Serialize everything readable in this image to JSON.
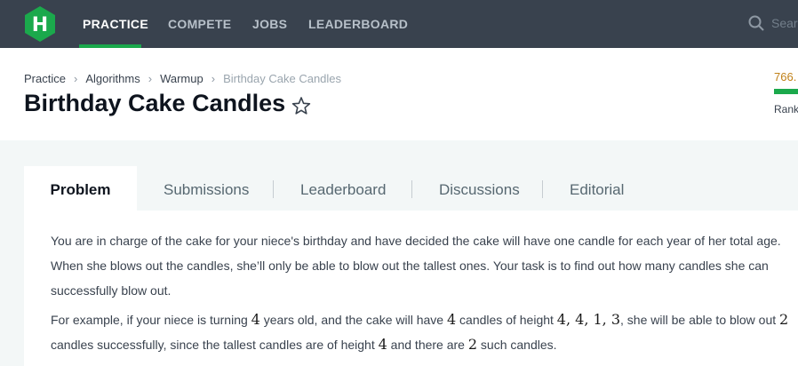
{
  "nav": {
    "items": [
      "PRACTICE",
      "COMPETE",
      "JOBS",
      "LEADERBOARD"
    ],
    "search_placeholder": "Sear"
  },
  "breadcrumb": [
    "Practice",
    "Algorithms",
    "Warmup",
    "Birthday Cake Candles"
  ],
  "title": "Birthday Cake Candles",
  "rank": {
    "points": "766.",
    "label": "Rank"
  },
  "tabs": [
    "Problem",
    "Submissions",
    "Leaderboard",
    "Discussions",
    "Editorial"
  ],
  "problem": {
    "p1": "You are in charge of the cake for your niece's birthday and have decided the cake will have one candle for each year of her total age. When she blows out the candles, she’ll only be able to blow out the tallest ones. Your task is to find out how many candles she can successfully blow out.",
    "p2_parts": [
      "For example, if your niece is turning ",
      "4",
      " years old, and the cake will have ",
      "4",
      " candles of height ",
      "4, 4, 1, 3",
      ", she will be able to blow out ",
      "2",
      " candles successfully, since the tallest candles are of height ",
      "4",
      " and there are ",
      "2",
      " such candles."
    ]
  },
  "colors": {
    "nav_bg": "#39424e",
    "accent": "#1ba94c",
    "rank": "#c08118"
  }
}
